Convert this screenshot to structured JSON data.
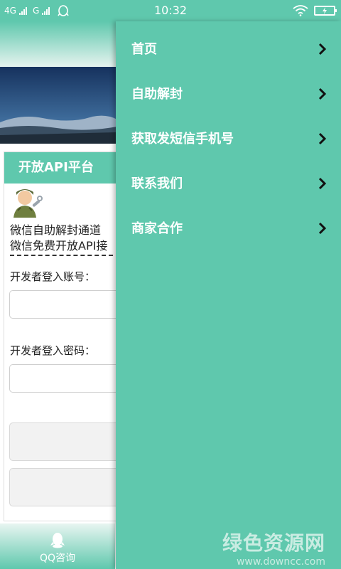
{
  "status_bar": {
    "network_1": "4G",
    "network_2": "G",
    "time": "10:32"
  },
  "background_page": {
    "card_tab_label": "开放API平台",
    "info_lines": [
      "微信自助解封通道",
      "微信免费开放API接"
    ],
    "login_account_label": "开发者登入账号：",
    "login_password_label": "开发者登入密码：",
    "qq_consult_label": "QQ咨询"
  },
  "drawer": {
    "items": [
      {
        "label": "首页"
      },
      {
        "label": "自助解封"
      },
      {
        "label": "获取发短信手机号"
      },
      {
        "label": "联系我们"
      },
      {
        "label": "商家合作"
      }
    ]
  },
  "watermark": {
    "title": "绿色资源网",
    "url": "www.downcc.com"
  },
  "colors": {
    "accent": "#5fc8ad",
    "status_text": "#ffffff"
  },
  "icons": [
    "signal-icon",
    "qq-icon",
    "wifi-icon",
    "battery-icon",
    "chevron-right-icon",
    "user-avatar-icon"
  ]
}
